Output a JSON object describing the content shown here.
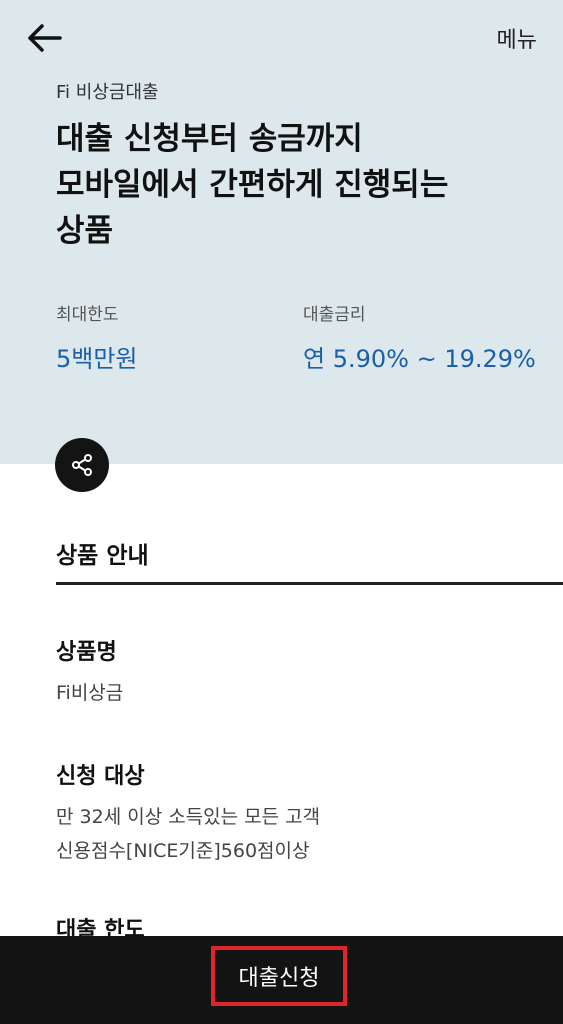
{
  "header": {
    "back_icon": "arrow-left-icon",
    "menu_label": "메뉴"
  },
  "hero": {
    "subtitle": "Fi 비상금대출",
    "headline_lines": [
      "대출 신청부터 송금까지",
      "모바일에서 간편하게 진행되는",
      "상품"
    ],
    "max_limit_label": "최대한도",
    "max_limit_value": "5백만원",
    "rate_label": "대출금리",
    "rate_value": "연 5.90% ~ 19.29%"
  },
  "share": {
    "icon": "share-icon"
  },
  "product_info": {
    "section_title": "상품 안내",
    "items": [
      {
        "heading": "상품명",
        "lines": [
          "Fi비상금"
        ]
      },
      {
        "heading": "신청 대상",
        "lines": [
          "만 32세 이상 소득있는 모든 고객",
          "신용점수[NICE기준]560점이상"
        ]
      },
      {
        "heading": "대출 한도",
        "lines": []
      }
    ]
  },
  "footer": {
    "apply_label": "대출신청"
  },
  "colors": {
    "hero_background": "#dde8ec",
    "accent_blue": "#1a5fa8",
    "bottom_bar": "#131313",
    "highlight_border": "#e0242a"
  }
}
